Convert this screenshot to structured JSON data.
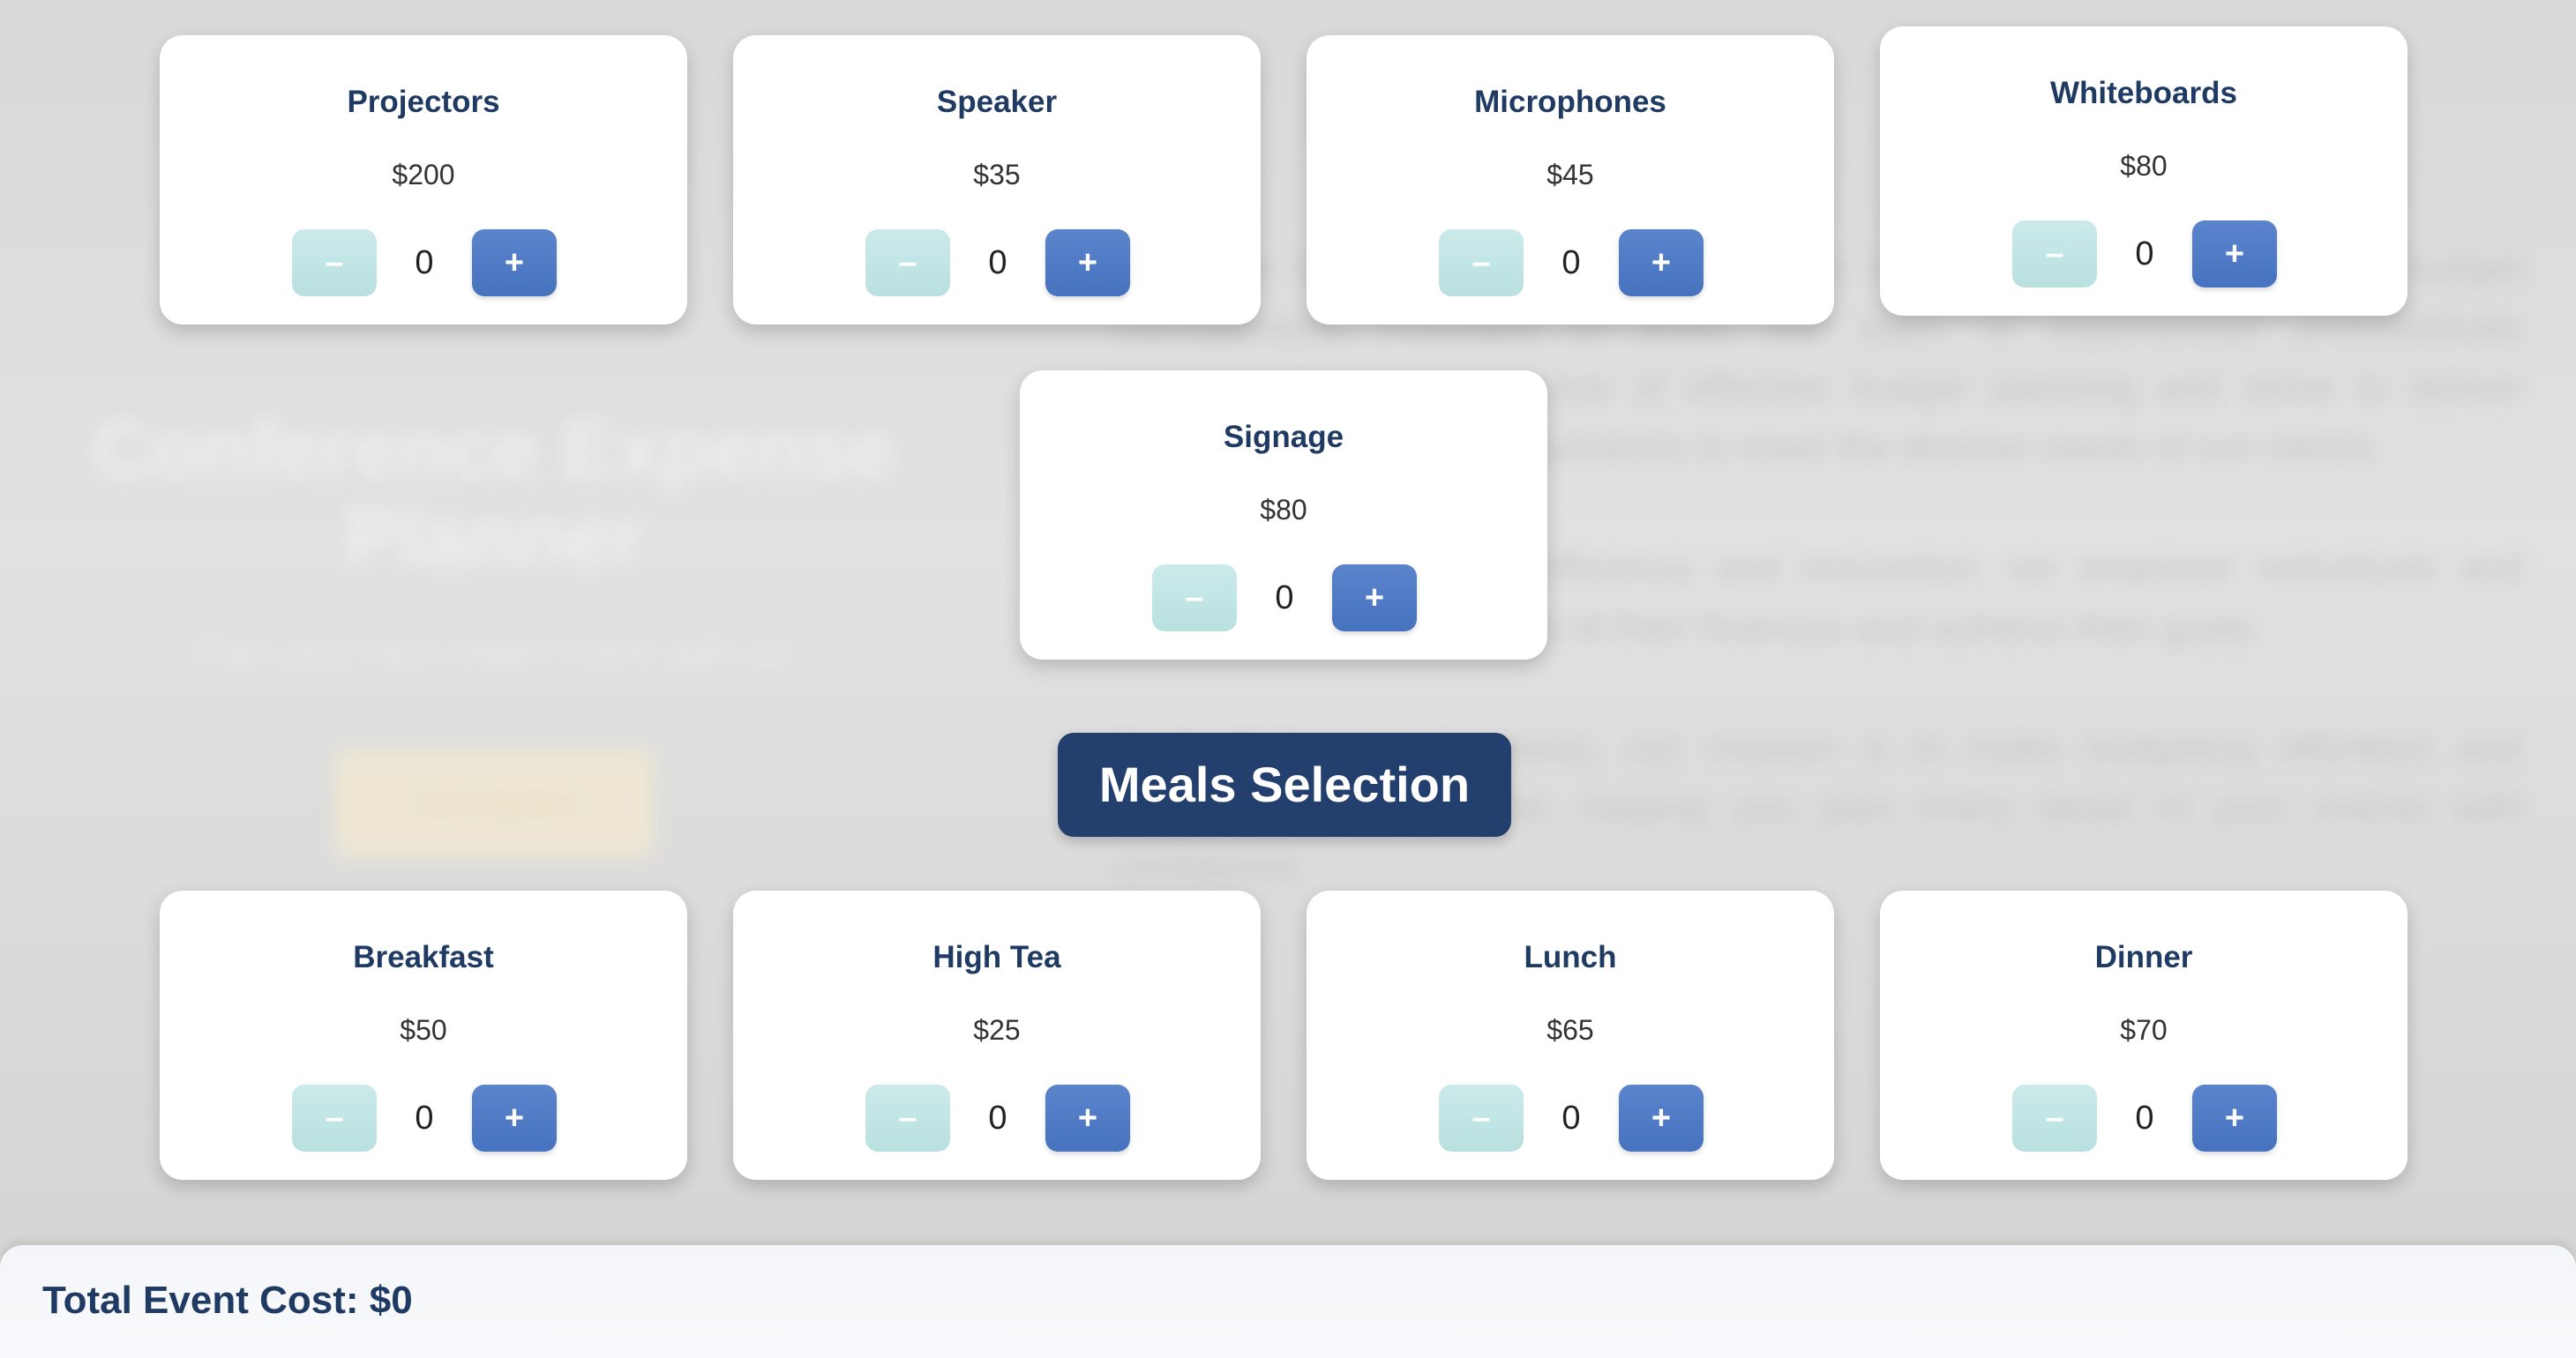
{
  "background": {
    "title": "Conference Expense Planner",
    "subtitle": "Plan your next major event with us!",
    "button_label": "Get Started",
    "paragraphs": [
      "Welcome to BudgetEase Solutions, your trusted partner in simplifying budget management. Founded in 2020, our team of experienced professionals understands the importance of effective budget planning and strive to deliver innovative, user-friendly solutions to meet the diverse needs of our clients.",
      "With a commitment to efficiency and innovation, we empower individuals and businesses to take control of their finances and achieve their goals.",
      "As budgetcare consultants, our mission is to make budgeting effortless and accessible for everyone, helping you plan every detail of your events with confidence."
    ]
  },
  "venue_items": [
    {
      "name": "Projectors",
      "price": "$200",
      "qty": "0",
      "minus": "–",
      "plus": "+"
    },
    {
      "name": "Speaker",
      "price": "$35",
      "qty": "0",
      "minus": "–",
      "plus": "+"
    },
    {
      "name": "Microphones",
      "price": "$45",
      "qty": "0",
      "minus": "–",
      "plus": "+"
    },
    {
      "name": "Whiteboards",
      "price": "$80",
      "qty": "0",
      "minus": "–",
      "plus": "+"
    },
    {
      "name": "Signage",
      "price": "$80",
      "qty": "0",
      "minus": "–",
      "plus": "+"
    }
  ],
  "meals": {
    "section_title": "Meals Selection",
    "items": [
      {
        "name": "Breakfast",
        "price": "$50",
        "qty": "0",
        "minus": "–",
        "plus": "+"
      },
      {
        "name": "High Tea",
        "price": "$25",
        "qty": "0",
        "minus": "–",
        "plus": "+"
      },
      {
        "name": "Lunch",
        "price": "$65",
        "qty": "0",
        "minus": "–",
        "plus": "+"
      },
      {
        "name": "Dinner",
        "price": "$70",
        "qty": "0",
        "minus": "–",
        "plus": "+"
      }
    ]
  },
  "footer": {
    "total_text": "Total Event Cost: $0"
  }
}
